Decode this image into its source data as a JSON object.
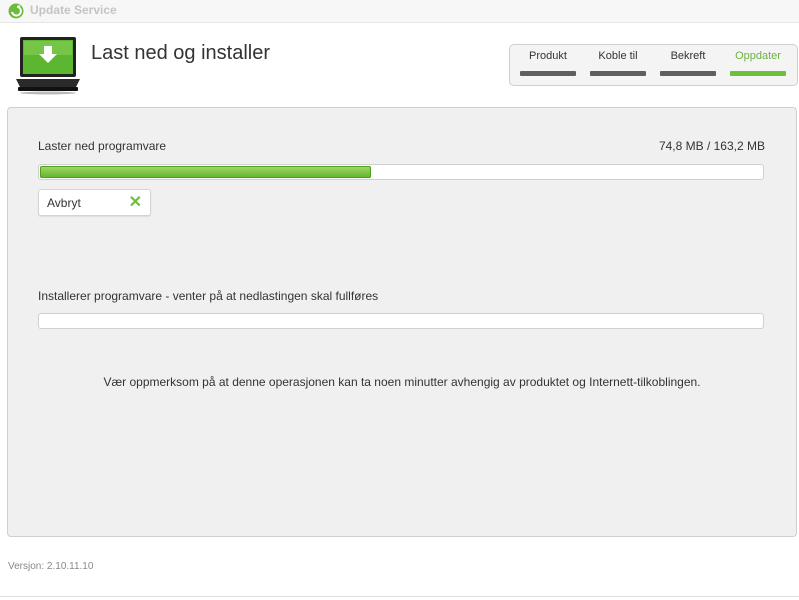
{
  "window": {
    "title": "Update Service"
  },
  "header": {
    "title": "Last ned og installer"
  },
  "steps": [
    {
      "label": "Produkt",
      "state": "done"
    },
    {
      "label": "Koble til",
      "state": "done"
    },
    {
      "label": "Bekreft",
      "state": "done"
    },
    {
      "label": "Oppdater",
      "state": "active"
    }
  ],
  "download": {
    "label": "Laster ned programvare",
    "size_text": "74,8 MB / 163,2 MB",
    "progress_fraction": 0.458,
    "cancel_label": "Avbryt"
  },
  "install": {
    "label": "Installerer programvare - venter på at nedlastingen skal fullføres",
    "progress_fraction": 0
  },
  "notice": "Vær oppmerksom på at denne operasjonen kan ta noen minutter avhengig av produktet og Internett-tilkoblingen.",
  "version": "Versjon: 2.10.11.10",
  "colors": {
    "accent_green": "#6dc038",
    "step_bar_inactive": "#5f5f5f"
  },
  "icons": {
    "app": "update-service-logo-icon",
    "header": "laptop-download-icon",
    "cancel": "close-x-icon"
  }
}
